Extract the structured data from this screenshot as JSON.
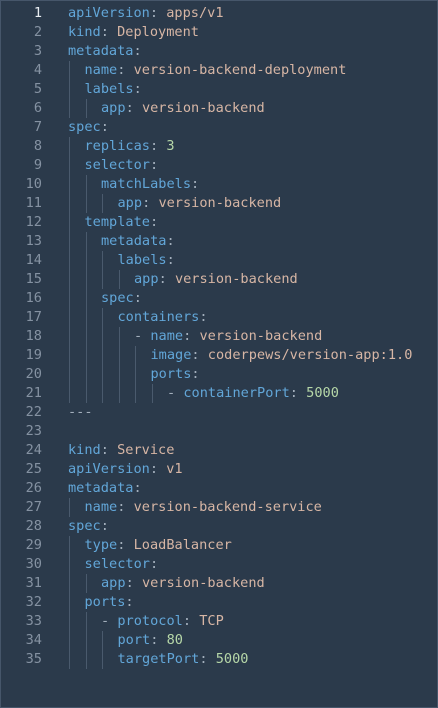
{
  "editor": {
    "active_line": 1,
    "lines": [
      {
        "n": "1",
        "indent": 0,
        "dash": "",
        "key": "apiVersion",
        "colon": ": ",
        "value": "apps/v1",
        "vtype": "str"
      },
      {
        "n": "2",
        "indent": 0,
        "dash": "",
        "key": "kind",
        "colon": ": ",
        "value": "Deployment",
        "vtype": "str"
      },
      {
        "n": "3",
        "indent": 0,
        "dash": "",
        "key": "metadata",
        "colon": ":",
        "value": "",
        "vtype": "str"
      },
      {
        "n": "4",
        "indent": 1,
        "dash": "",
        "key": "name",
        "colon": ": ",
        "value": "version-backend-deployment",
        "vtype": "str"
      },
      {
        "n": "5",
        "indent": 1,
        "dash": "",
        "key": "labels",
        "colon": ":",
        "value": "",
        "vtype": "str"
      },
      {
        "n": "6",
        "indent": 2,
        "dash": "",
        "key": "app",
        "colon": ": ",
        "value": "version-backend",
        "vtype": "str"
      },
      {
        "n": "7",
        "indent": 0,
        "dash": "",
        "key": "spec",
        "colon": ":",
        "value": "",
        "vtype": "str"
      },
      {
        "n": "8",
        "indent": 1,
        "dash": "",
        "key": "replicas",
        "colon": ": ",
        "value": "3",
        "vtype": "num"
      },
      {
        "n": "9",
        "indent": 1,
        "dash": "",
        "key": "selector",
        "colon": ":",
        "value": "",
        "vtype": "str"
      },
      {
        "n": "10",
        "indent": 2,
        "dash": "",
        "key": "matchLabels",
        "colon": ":",
        "value": "",
        "vtype": "str"
      },
      {
        "n": "11",
        "indent": 3,
        "dash": "",
        "key": "app",
        "colon": ": ",
        "value": "version-backend",
        "vtype": "str"
      },
      {
        "n": "12",
        "indent": 1,
        "dash": "",
        "key": "template",
        "colon": ":",
        "value": "",
        "vtype": "str"
      },
      {
        "n": "13",
        "indent": 2,
        "dash": "",
        "key": "metadata",
        "colon": ":",
        "value": "",
        "vtype": "str"
      },
      {
        "n": "14",
        "indent": 3,
        "dash": "",
        "key": "labels",
        "colon": ":",
        "value": "",
        "vtype": "str"
      },
      {
        "n": "15",
        "indent": 4,
        "dash": "",
        "key": "app",
        "colon": ": ",
        "value": "version-backend",
        "vtype": "str"
      },
      {
        "n": "16",
        "indent": 2,
        "dash": "",
        "key": "spec",
        "colon": ":",
        "value": "",
        "vtype": "str"
      },
      {
        "n": "17",
        "indent": 3,
        "dash": "",
        "key": "containers",
        "colon": ":",
        "value": "",
        "vtype": "str"
      },
      {
        "n": "18",
        "indent": 4,
        "dash": "- ",
        "key": "name",
        "colon": ": ",
        "value": "version-backend",
        "vtype": "str"
      },
      {
        "n": "19",
        "indent": 5,
        "dash": "",
        "key": "image",
        "colon": ": ",
        "value": "coderpews/version-app:1.0",
        "vtype": "str"
      },
      {
        "n": "20",
        "indent": 5,
        "dash": "",
        "key": "ports",
        "colon": ":",
        "value": "",
        "vtype": "str"
      },
      {
        "n": "21",
        "indent": 6,
        "dash": "- ",
        "key": "containerPort",
        "colon": ": ",
        "value": "5000",
        "vtype": "num"
      },
      {
        "n": "22",
        "indent": 0,
        "dash": "",
        "key": "",
        "colon": "",
        "value": "---",
        "vtype": "sep"
      },
      {
        "n": "23",
        "indent": 0,
        "dash": "",
        "key": "",
        "colon": "",
        "value": "",
        "vtype": "str"
      },
      {
        "n": "24",
        "indent": 0,
        "dash": "",
        "key": "kind",
        "colon": ": ",
        "value": "Service",
        "vtype": "str"
      },
      {
        "n": "25",
        "indent": 0,
        "dash": "",
        "key": "apiVersion",
        "colon": ": ",
        "value": "v1",
        "vtype": "str"
      },
      {
        "n": "26",
        "indent": 0,
        "dash": "",
        "key": "metadata",
        "colon": ":",
        "value": "",
        "vtype": "str"
      },
      {
        "n": "27",
        "indent": 1,
        "dash": "",
        "key": "name",
        "colon": ": ",
        "value": "version-backend-service",
        "vtype": "str"
      },
      {
        "n": "28",
        "indent": 0,
        "dash": "",
        "key": "spec",
        "colon": ":",
        "value": "",
        "vtype": "str"
      },
      {
        "n": "29",
        "indent": 1,
        "dash": "",
        "key": "type",
        "colon": ": ",
        "value": "LoadBalancer",
        "vtype": "str"
      },
      {
        "n": "30",
        "indent": 1,
        "dash": "",
        "key": "selector",
        "colon": ":",
        "value": "",
        "vtype": "str"
      },
      {
        "n": "31",
        "indent": 2,
        "dash": "",
        "key": "app",
        "colon": ": ",
        "value": "version-backend",
        "vtype": "str"
      },
      {
        "n": "32",
        "indent": 1,
        "dash": "",
        "key": "ports",
        "colon": ":",
        "value": "",
        "vtype": "str"
      },
      {
        "n": "33",
        "indent": 2,
        "dash": "- ",
        "key": "protocol",
        "colon": ": ",
        "value": "TCP",
        "vtype": "str"
      },
      {
        "n": "34",
        "indent": 3,
        "dash": "",
        "key": "port",
        "colon": ": ",
        "value": "80",
        "vtype": "num"
      },
      {
        "n": "35",
        "indent": 3,
        "dash": "",
        "key": "targetPort",
        "colon": ": ",
        "value": "5000",
        "vtype": "num"
      }
    ]
  }
}
